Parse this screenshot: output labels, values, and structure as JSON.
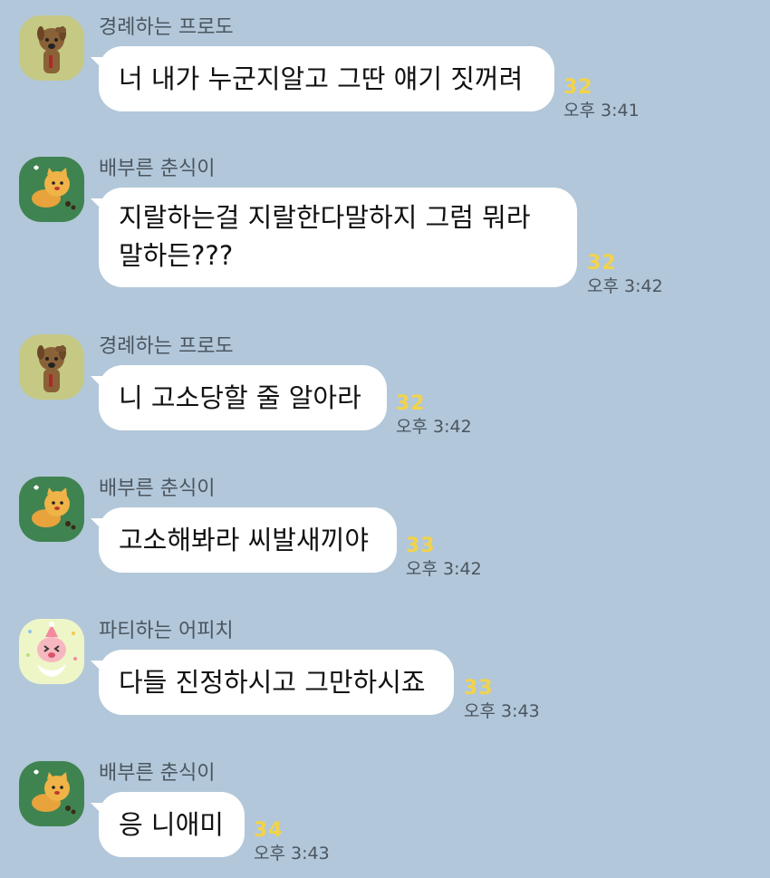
{
  "messages": [
    {
      "sender": "경례하는 프로도",
      "text": [
        "너 내가 누군지알고 그딴 얘기 짓꺼려"
      ],
      "unread": "32",
      "time": "오후 3:41"
    },
    {
      "sender": "배부른 춘식이",
      "text": [
        "지랄하는걸 지랄한다말하지 그럼 뭐라",
        "말하든???"
      ],
      "unread": "32",
      "time": "오후 3:42"
    },
    {
      "sender": "경례하는 프로도",
      "text": [
        "니 고소당할 줄 알아라"
      ],
      "unread": "32",
      "time": "오후 3:42"
    },
    {
      "sender": "배부른 춘식이",
      "text": [
        "고소해봐라 씨발새끼야"
      ],
      "unread": "33",
      "time": "오후 3:42"
    },
    {
      "sender": "파티하는 어피치",
      "text": [
        "다들 진정하시고 그만하시죠"
      ],
      "unread": "33",
      "time": "오후 3:43"
    },
    {
      "sender": "배부른 춘식이",
      "text": [
        "응 니애미"
      ],
      "unread": "34",
      "time": "오후 3:43"
    }
  ],
  "avatars": {
    "frodo": {
      "icon": "frodo-dog-saluting-icon",
      "bg": "#c5c983"
    },
    "choonsik": {
      "icon": "choonsik-cat-lying-icon",
      "bg": "#3f8350"
    },
    "apeach": {
      "icon": "apeach-party-icon",
      "bg": "#eef6c8"
    }
  },
  "colors": {
    "background": "#b2c7d9",
    "bubble": "#ffffff",
    "unread": "#f2d34a"
  }
}
